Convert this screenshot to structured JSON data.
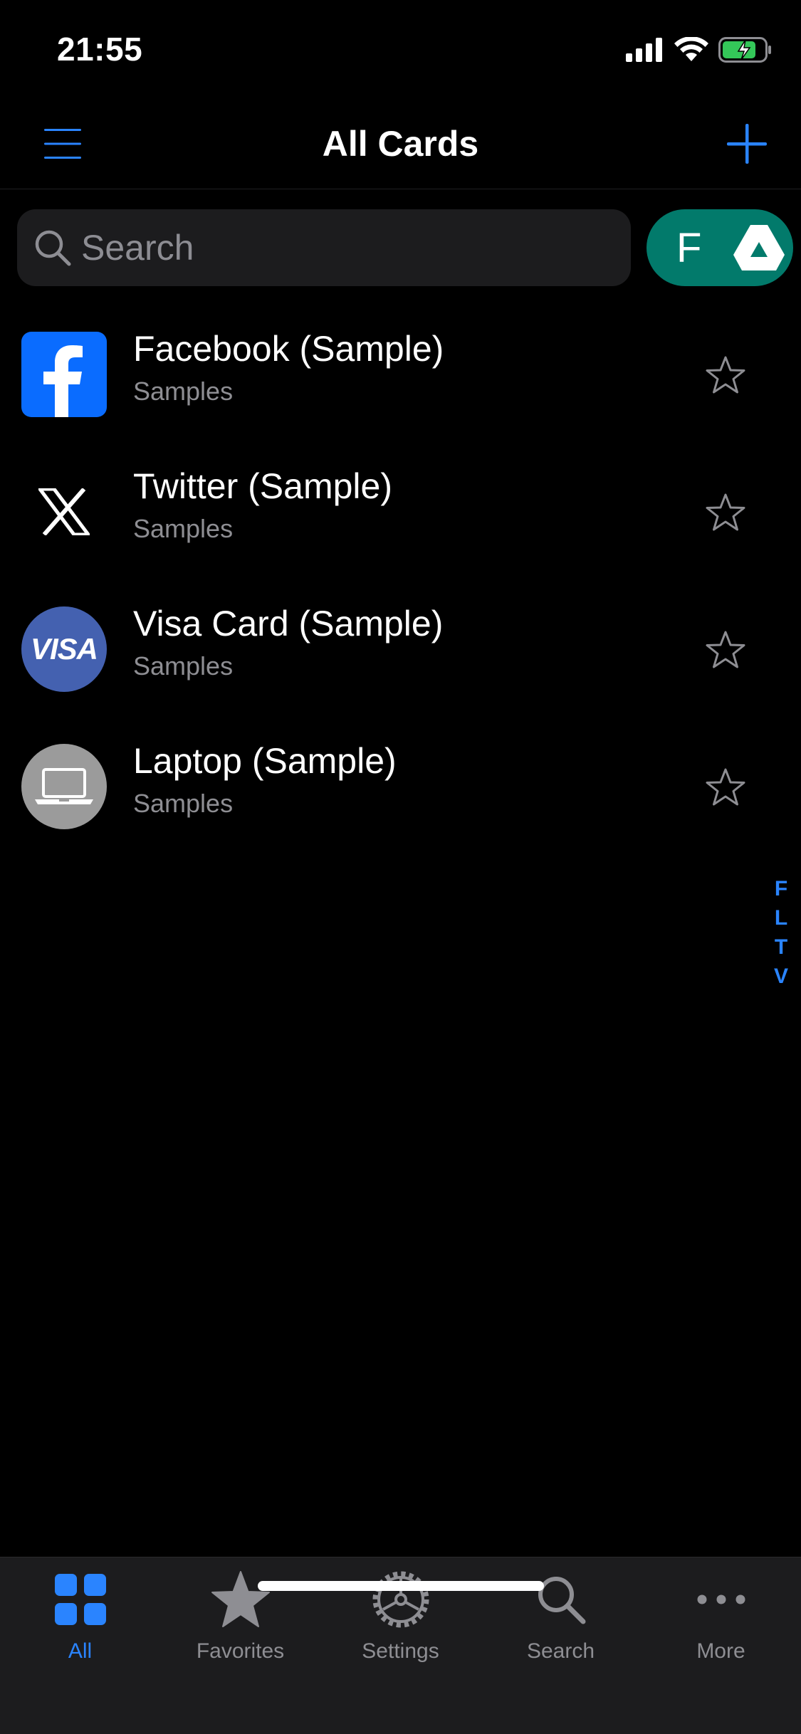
{
  "status_bar": {
    "time": "21:55",
    "icons": [
      "cellular-signal-icon",
      "wifi-icon",
      "battery-charging-icon"
    ]
  },
  "nav": {
    "title": "All Cards",
    "menu_icon": "hamburger-menu-icon",
    "add_icon": "plus-icon"
  },
  "search": {
    "placeholder": "Search",
    "icon": "magnifying-glass-icon"
  },
  "filter_pill": {
    "letter": "F",
    "icon": "google-drive-icon",
    "color": "#027a6b"
  },
  "cards": [
    {
      "title": "Facebook (Sample)",
      "subtitle": "Samples",
      "icon": "facebook-logo-icon",
      "favorite": false
    },
    {
      "title": "Twitter (Sample)",
      "subtitle": "Samples",
      "icon": "x-logo-icon",
      "favorite": false
    },
    {
      "title": "Visa Card (Sample)",
      "subtitle": "Samples",
      "icon": "visa-logo-icon",
      "icon_text": "VISA",
      "favorite": false
    },
    {
      "title": "Laptop (Sample)",
      "subtitle": "Samples",
      "icon": "laptop-icon",
      "favorite": false
    }
  ],
  "section_index": [
    "F",
    "L",
    "T",
    "V"
  ],
  "tabs": [
    {
      "label": "All",
      "icon": "grid-icon",
      "active": true
    },
    {
      "label": "Favorites",
      "icon": "star-icon",
      "active": false
    },
    {
      "label": "Settings",
      "icon": "gear-icon",
      "active": false
    },
    {
      "label": "Search",
      "icon": "magnifying-glass-icon",
      "active": false
    },
    {
      "label": "More",
      "icon": "ellipsis-icon",
      "active": false
    }
  ],
  "colors": {
    "accent": "#2a84ff",
    "background": "#000000",
    "secondary_text": "#8e8e93",
    "tab_bar": "#1c1c1e"
  }
}
